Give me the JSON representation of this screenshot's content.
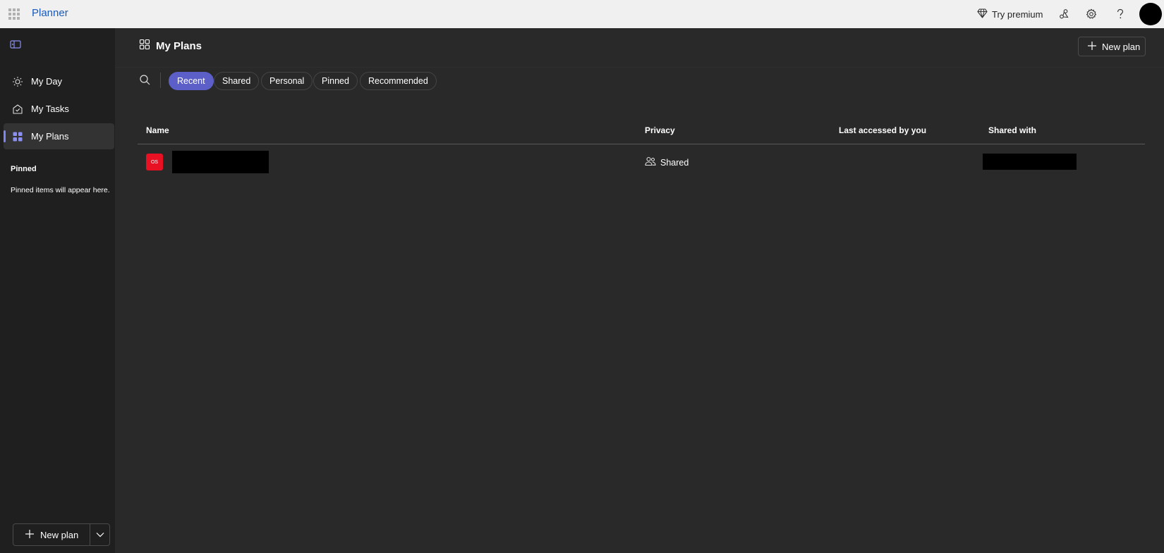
{
  "app": {
    "title": "Planner"
  },
  "topbar": {
    "premium_label": "Try premium"
  },
  "sidebar": {
    "items": [
      {
        "label": "My Day",
        "icon": "sun-icon"
      },
      {
        "label": "My Tasks",
        "icon": "tasks-icon"
      },
      {
        "label": "My Plans",
        "icon": "grid-icon",
        "active": true
      }
    ],
    "pinned_heading": "Pinned",
    "pinned_empty": "Pinned items will appear here.",
    "new_plan_label": "New plan"
  },
  "main": {
    "title": "My Plans",
    "new_plan_label": "New plan",
    "filters": [
      {
        "label": "Recent",
        "selected": true
      },
      {
        "label": "Shared",
        "selected": false
      },
      {
        "label": "Personal",
        "selected": false
      },
      {
        "label": "Pinned",
        "selected": false
      },
      {
        "label": "Recommended",
        "selected": false
      }
    ],
    "columns": [
      "Name",
      "Privacy",
      "Last accessed by you",
      "Shared with"
    ],
    "rows": [
      {
        "badge": "OS",
        "badge_color": "#e81123",
        "privacy": "Shared"
      }
    ]
  },
  "colors": {
    "accent": "#5b5fc7",
    "brand": "#185abd",
    "badge": "#e81123"
  }
}
